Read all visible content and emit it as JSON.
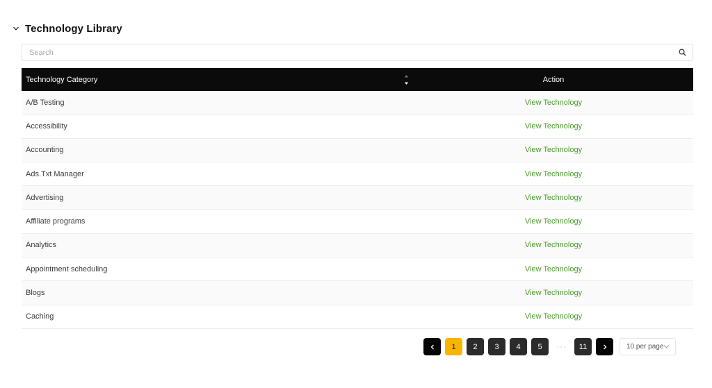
{
  "section": {
    "title": "Technology Library",
    "icon": "chevron-down-icon"
  },
  "search": {
    "placeholder": "Search",
    "value": "",
    "icon": "search-icon"
  },
  "table": {
    "columns": [
      "Technology Category",
      "Action"
    ],
    "sort_icon": "sort-icon",
    "rows": [
      {
        "category": "A/B Testing",
        "action": "View Technology"
      },
      {
        "category": "Accessibility",
        "action": "View Technology"
      },
      {
        "category": "Accounting",
        "action": "View Technology"
      },
      {
        "category": "Ads.Txt Manager",
        "action": "View Technology"
      },
      {
        "category": "Advertising",
        "action": "View Technology"
      },
      {
        "category": "Affiliate programs",
        "action": "View Technology"
      },
      {
        "category": "Analytics",
        "action": "View Technology"
      },
      {
        "category": "Appointment scheduling",
        "action": "View Technology"
      },
      {
        "category": "Blogs",
        "action": "View Technology"
      },
      {
        "category": "Caching",
        "action": "View Technology"
      }
    ]
  },
  "pagination": {
    "prev_icon": "chevron-left-icon",
    "next_icon": "chevron-right-icon",
    "pages": [
      "1",
      "2",
      "3",
      "4",
      "5"
    ],
    "ellipsis": "···",
    "last_page": "11",
    "current_page": "1",
    "per_page": "10 per page"
  },
  "colors": {
    "header_bg": "#0b0b0b",
    "link_green": "#4a9d2a",
    "active_page": "#f7b500"
  }
}
